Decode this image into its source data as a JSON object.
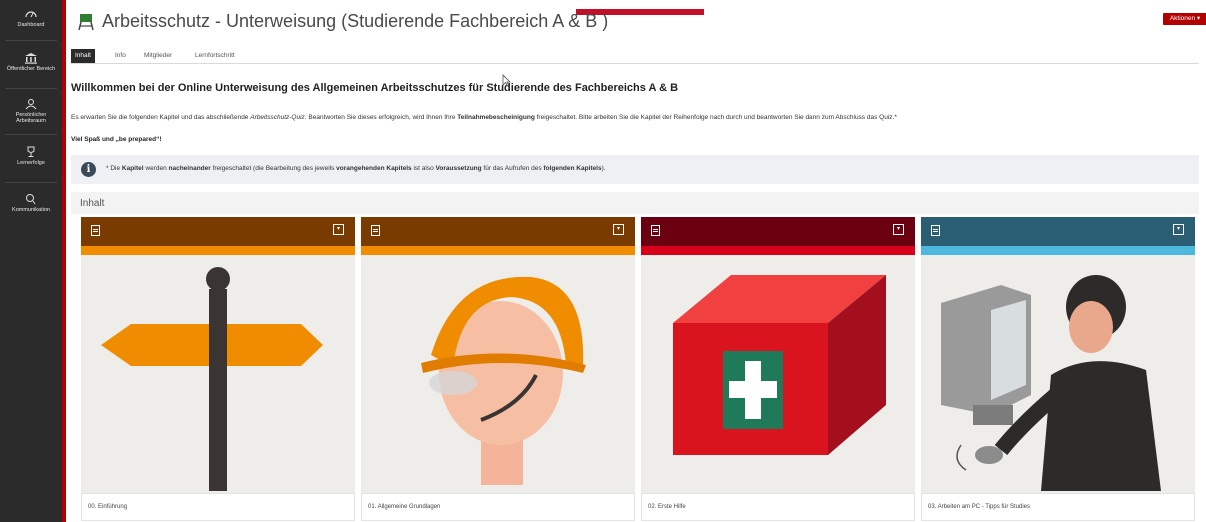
{
  "sidebar": {
    "items": [
      {
        "label": "Dashboard",
        "icon": "dashboard-icon"
      },
      {
        "label": "Öffentlicher Bereich",
        "icon": "institution-icon"
      },
      {
        "label": "Persönlicher Arbeitsraum",
        "icon": "person-icon"
      },
      {
        "label": "Lernerfolge",
        "icon": "trophy-icon"
      },
      {
        "label": "Kommunikation",
        "icon": "chat-icon"
      }
    ]
  },
  "header": {
    "title": "Arbeitsschutz - Unterweisung (Studierende Fachbereich A & B )",
    "actions_label": "Aktionen ▾"
  },
  "tabs": [
    {
      "label": "Inhalt",
      "active": true
    },
    {
      "label": "Info",
      "active": false
    },
    {
      "label": "Mitglieder",
      "active": false
    },
    {
      "label": "Lernfortschritt",
      "active": false
    }
  ],
  "main": {
    "heading": "Willkommen bei der Online Unterweisung des Allgemeinen Arbeitsschutzes für Studierende des Fachbereichs A & B",
    "intro_parts": [
      "Es erwarten Sie die folgenden Kapitel und das abschließende ",
      "Arbeitsschutz-Quiz",
      ". Beantworten Sie dieses erfolgreich, wird Ihnen Ihre ",
      "Teilnahmebescheinigung",
      " freigeschaltet. Bitte arbeiten Sie die Kapitel der Reihenfolge nach durch und beantworten Sie dann zum Abschluss das Quiz.*"
    ],
    "fun_line": "Viel Spaß und „be prepared“!",
    "info_parts": [
      "* Die ",
      "Kapitel",
      " werden ",
      "nacheinander",
      " freigeschaltet (die Bearbeitung des jeweils ",
      "vorangehenden Kapitels",
      " ist also ",
      "Voraussetzung",
      " für das Aufrufen des ",
      "folgenden Kapitels",
      ")."
    ],
    "section_title": "Inhalt"
  },
  "tiles": [
    {
      "caption": "00. Einführung",
      "head_color": "#7a3b00",
      "stripe_color": "#f08c00",
      "icon": "signpost-icon"
    },
    {
      "caption": "01. Allgemeine Grundlagen",
      "head_color": "#7a3b00",
      "stripe_color": "#f08c00",
      "icon": "hardhat-icon"
    },
    {
      "caption": "02. Erste Hilfe",
      "head_color": "#6b0010",
      "stripe_color": "#d9001b",
      "icon": "first-aid-icon"
    },
    {
      "caption": "03. Arbeiten am PC - Tipps für Studies",
      "head_color": "#2a5f73",
      "stripe_color": "#4cb8dd",
      "icon": "computer-user-icon"
    }
  ],
  "colors": {
    "sidebar_bg": "#2b2b2b",
    "accent_red": "#b30000"
  }
}
